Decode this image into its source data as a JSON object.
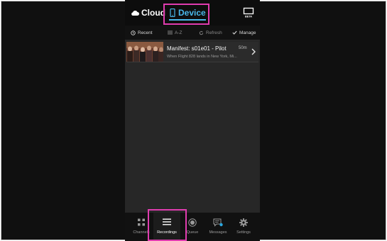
{
  "header": {
    "cloud_tab_label": "Cloud",
    "device_tab_label": "Device",
    "cast_badge": "BETA"
  },
  "filters": {
    "recent_label": "Recent",
    "az_label": "A-Z",
    "refresh_label": "Refresh",
    "manage_label": "Manage"
  },
  "recordings": [
    {
      "title": "Manifest: s01e01 - Pilot",
      "duration": "50m",
      "description": "When Flight 828 lands in New York, Mi..."
    }
  ],
  "bottom_nav": {
    "channels_label": "Channels",
    "recordings_label": "Recordings",
    "queue_label": "Queue",
    "messages_label": "Messages",
    "settings_label": "Settings"
  },
  "colors": {
    "accent": "#4ab7ea",
    "highlight": "#e03caf",
    "badge_dot": "#2aa8e0"
  }
}
